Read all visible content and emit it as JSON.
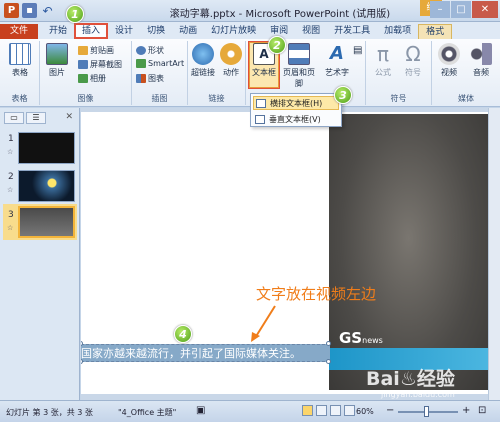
{
  "app": {
    "window_title": "滚动字幕.pptx - Microsoft PowerPoint (试用版)",
    "tool_badge": "绘",
    "window_buttons": [
      "–",
      "□",
      "✕"
    ]
  },
  "tabs": [
    {
      "label": "文件"
    },
    {
      "label": "开始"
    },
    {
      "label": "插入"
    },
    {
      "label": "设计"
    },
    {
      "label": "切换"
    },
    {
      "label": "动画"
    },
    {
      "label": "幻灯片放映"
    },
    {
      "label": "审阅"
    },
    {
      "label": "视图"
    },
    {
      "label": "开发工具"
    },
    {
      "label": "加载项"
    },
    {
      "label": "格式"
    }
  ],
  "ribbon": {
    "groups": {
      "tables": "表格",
      "images": "图像",
      "illustrations": "插图",
      "links": "链接",
      "text": "文本",
      "symbols": "符号",
      "media": "媒体"
    },
    "table_btn": "表格",
    "picture_btn": "图片",
    "clipart_btn": "剪贴画",
    "screenshot_btn": "屏幕截图",
    "album_btn": "相册",
    "shapes_btn": "形状",
    "smartart_btn": "SmartArt",
    "chart_btn": "图表",
    "hyperlink_btn": "超链接",
    "action_btn": "动作",
    "textbox_btn": "文本框",
    "header_footer_btn": "页眉和页脚",
    "wordart_btn": "艺术字",
    "equation_btn": "公式",
    "symbol_btn": "符号",
    "video_btn": "视频",
    "audio_btn": "音频"
  },
  "dropdown": {
    "horizontal": "横排文本框(H)",
    "vertical": "垂直文本框(V)"
  },
  "markers": [
    "1",
    "2",
    "3",
    "4"
  ],
  "slides_pane": {
    "numbers": [
      "1",
      "2",
      "3"
    ],
    "star": "☆"
  },
  "slide": {
    "callout": "文字放在视频左边",
    "scroll_text": "国家亦越来越流行，并引起了国际媒体关注。",
    "logo_main": "GS",
    "logo_sub": "news",
    "watermark": "Bai♨经验",
    "watermark_url": "jingyan.baidu.com"
  },
  "statusbar": {
    "slide_info": "幻灯片 第 3 张，共 3 张",
    "theme": "\"4_Office 主题\"",
    "zoom": "60%"
  }
}
